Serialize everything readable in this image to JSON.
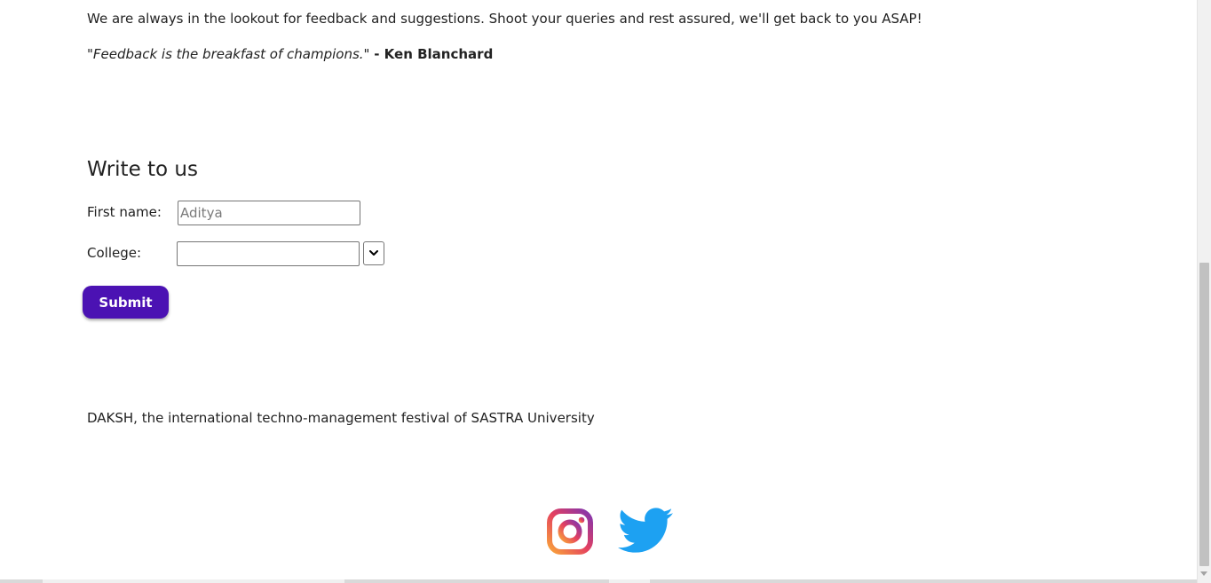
{
  "intro": {
    "text": "We are always in the lookout for feedback and suggestions. Shoot your queries and rest assured, we'll get back to you ASAP!"
  },
  "quote": {
    "text": "\"Feedback is the breakfast of champions.\"",
    "author": "- Ken Blanchard"
  },
  "contact_form": {
    "title": "Write to us",
    "first_name_label": "First name:",
    "first_name_placeholder": "Aditya",
    "first_name_value": "",
    "college_label": "College:",
    "college_value": "",
    "submit_label": "Submit"
  },
  "footer": {
    "text": "DAKSH, the international techno-management festival of SASTRA University"
  },
  "social": {
    "instagram_icon": "instagram-icon",
    "twitter_icon": "twitter-icon",
    "twitter_color": "#1da1f2",
    "instagram_gradient": [
      "#f9a43a",
      "#e4405f",
      "#8134af"
    ]
  },
  "colors": {
    "accent": "#4b12b3",
    "text": "#222222"
  }
}
